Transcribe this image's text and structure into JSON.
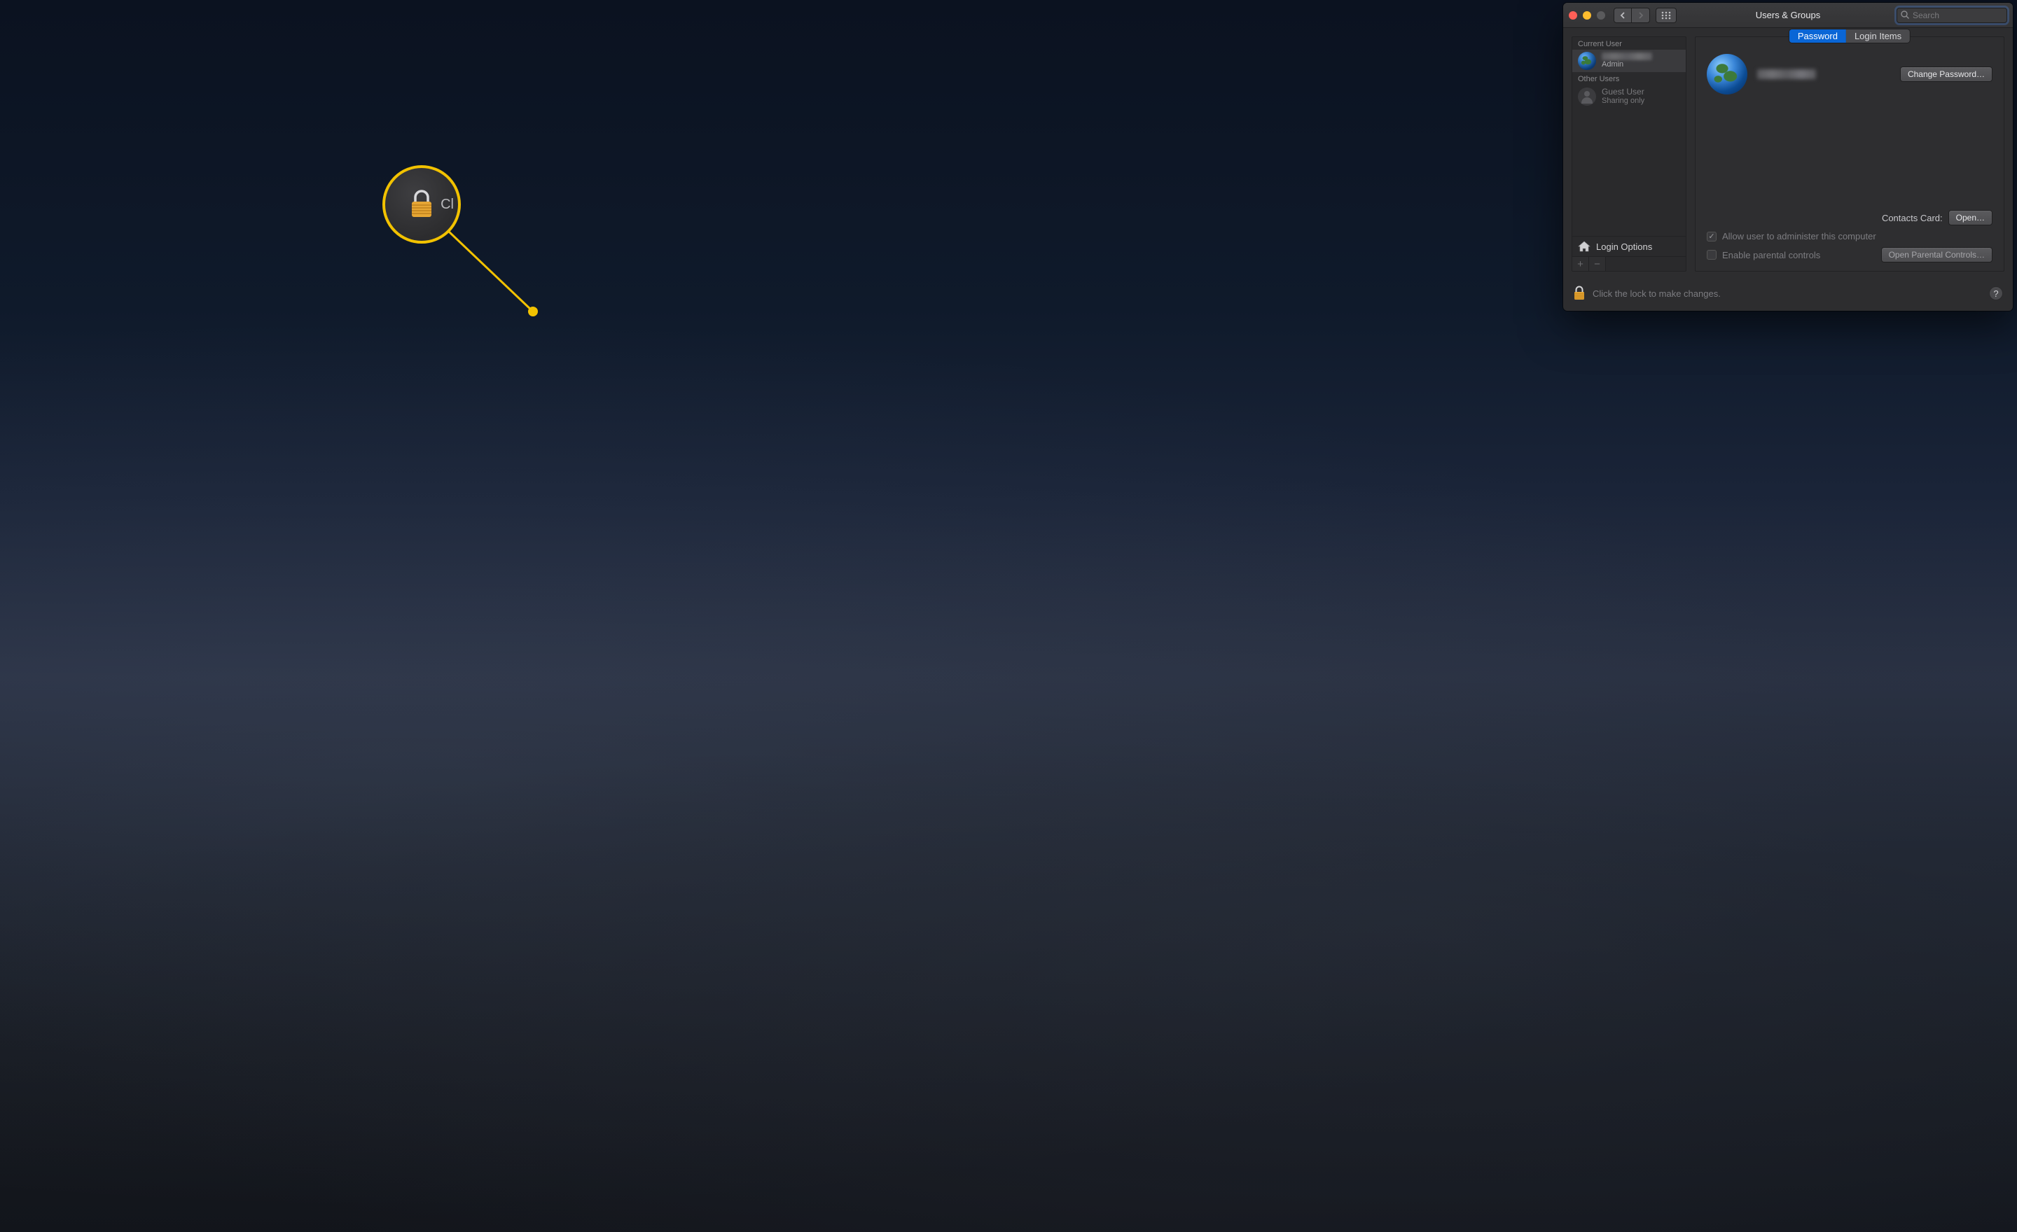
{
  "window": {
    "title": "Users & Groups",
    "search_placeholder": "Search"
  },
  "tabs": {
    "password": "Password",
    "login_items": "Login Items"
  },
  "sidebar": {
    "current_user_header": "Current User",
    "other_users_header": "Other Users",
    "current_user": {
      "role": "Admin"
    },
    "other_users": [
      {
        "name": "Guest User",
        "sub": "Sharing only"
      }
    ],
    "login_options": "Login Options"
  },
  "main": {
    "change_password": "Change Password…",
    "contacts_card_label": "Contacts Card:",
    "open": "Open…",
    "allow_admin": "Allow user to administer this computer",
    "enable_parental": "Enable parental controls",
    "open_parental": "Open Parental Controls…"
  },
  "footer": {
    "lock_hint": "Click the lock to make changes."
  },
  "callout": {
    "text_fragment": "Cl"
  },
  "colors": {
    "accent": "#0a66d6",
    "highlight": "#f2c200"
  }
}
